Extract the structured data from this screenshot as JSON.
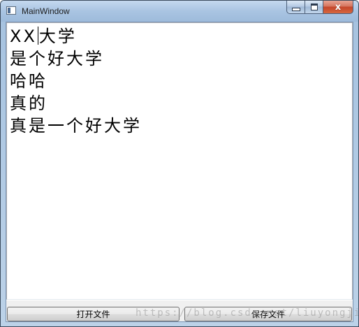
{
  "window": {
    "title": "MainWindow",
    "controls": {
      "minimize_icon": "minimize-icon",
      "maximize_icon": "maximize-icon",
      "close_icon": "close-icon",
      "close_glyph": "x"
    }
  },
  "editor": {
    "lines": [
      {
        "before_caret": "XX",
        "after_caret": "大学"
      },
      {
        "text": "是个好大学"
      },
      {
        "text": "哈哈"
      },
      {
        "text": "真的"
      },
      {
        "text": "真是一个好大学"
      }
    ]
  },
  "buttons": {
    "open_label": "打开文件",
    "save_label": "保存文件"
  },
  "watermark": "https://blog.csdn.net/liuyongjie",
  "colors": {
    "titlebar": "#a9c4e2",
    "close_button": "#c4452a",
    "button_face": "#e6e6e6",
    "client_background": "#ffffff"
  }
}
